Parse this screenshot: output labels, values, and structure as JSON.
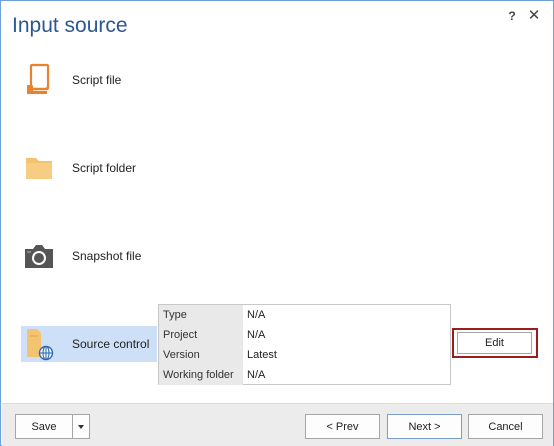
{
  "window": {
    "title": "Input source",
    "help_label": "?",
    "close_label": "✕"
  },
  "sources": [
    {
      "label": "Script file",
      "icon": "script-file-icon"
    },
    {
      "label": "Script folder",
      "icon": "folder-icon"
    },
    {
      "label": "Snapshot file",
      "icon": "camera-icon"
    },
    {
      "label": "Source control",
      "icon": "source-control-icon",
      "selected": true
    }
  ],
  "details": [
    {
      "key": "Type",
      "value": "N/A"
    },
    {
      "key": "Project",
      "value": "N/A"
    },
    {
      "key": "Version",
      "value": "Latest"
    },
    {
      "key": "Working folder",
      "value": "N/A"
    }
  ],
  "edit_label": "Edit",
  "footer": {
    "save_label": "Save",
    "prev_label": "< Prev",
    "next_label": "Next >",
    "cancel_label": "Cancel"
  },
  "colors": {
    "title": "#2b5797",
    "accent_orange": "#e8822c",
    "folder": "#f4c36f",
    "selection": "#cde0f7",
    "edit_highlight": "#9b1c1c"
  }
}
